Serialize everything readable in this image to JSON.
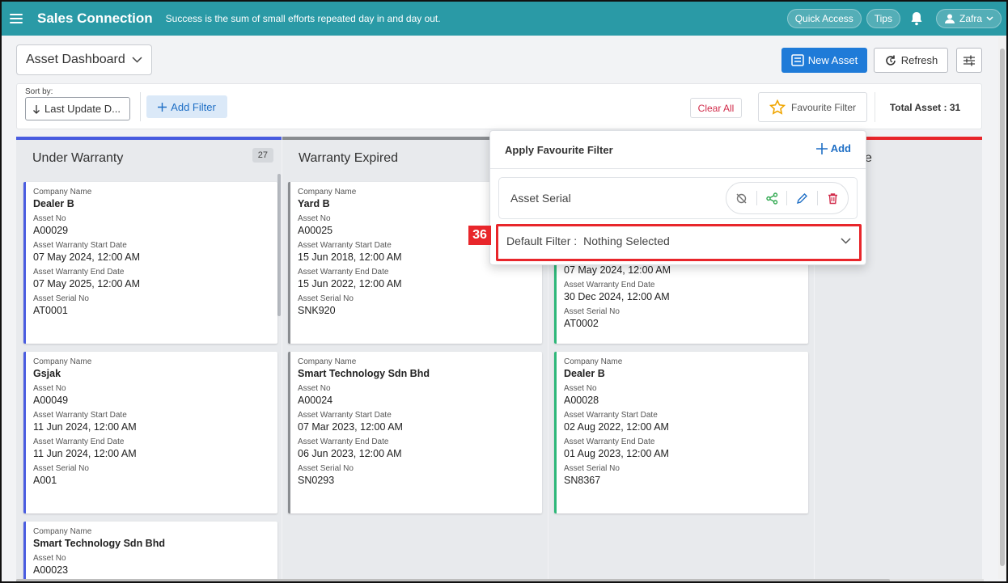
{
  "topbar": {
    "app_title": "Sales Connection",
    "tagline": "Success is the sum of small efforts repeated day in and day out.",
    "quick_access": "Quick Access",
    "tips": "Tips",
    "user_name": "Zafra",
    "color": "#2a9aa6"
  },
  "header": {
    "dashboard_select": "Asset Dashboard",
    "new_asset": "New Asset",
    "refresh": "Refresh"
  },
  "filter_bar": {
    "sort_label": "Sort by:",
    "sort_value": "Last Update D...",
    "add_filter": "Add Filter",
    "clear_all": "Clear All",
    "favourite_filter": "Favourite Filter",
    "total_asset": "Total Asset : 31"
  },
  "columns": [
    {
      "title": "Under Warranty",
      "count": "27",
      "color": "#4a5de0",
      "cards": [
        {
          "company": "Dealer B",
          "asset_no": "A00029",
          "start": "07 May 2024, 12:00 AM",
          "end": "07 May 2025, 12:00 AM",
          "serial": "AT0001"
        },
        {
          "company": "Gsjak",
          "asset_no": "A00049",
          "start": "11 Jun 2024, 12:00 AM",
          "end": "11 Jun 2024, 12:00 AM",
          "serial": "A001"
        },
        {
          "company": "Smart Technology Sdn Bhd",
          "asset_no": "A00023"
        }
      ]
    },
    {
      "title": "Warranty Expired",
      "color": "#8a8d91",
      "cards": [
        {
          "company": "Yard B",
          "asset_no": "A00025",
          "start": "15 Jun 2018, 12:00 AM",
          "end": "15 Jun 2022, 12:00 AM",
          "serial": "SNK920"
        },
        {
          "company": "Smart Technology Sdn Bhd",
          "asset_no": "A00024",
          "start": "07 Mar 2023, 12:00 AM",
          "end": "06 Jun 2023, 12:00 AM",
          "serial": "SN0293"
        }
      ]
    },
    {
      "title": "",
      "color": "#2fb87a",
      "cards": [
        {
          "start": "07 May 2024, 12:00 AM",
          "end": "30 Dec 2024, 12:00 AM",
          "serial": "AT0002"
        },
        {
          "company": "Dealer B",
          "asset_no": "A00028",
          "start": "02 Aug 2022, 12:00 AM",
          "end": "01 Aug 2023, 12:00 AM",
          "serial": "SN8367"
        }
      ]
    },
    {
      "title_partial": "e",
      "color": "#e8262b"
    }
  ],
  "labels": {
    "company_name": "Company Name",
    "asset_no": "Asset No",
    "start": "Asset Warranty Start Date",
    "end": "Asset Warranty End Date",
    "serial": "Asset Serial No"
  },
  "popup": {
    "title": "Apply Favourite Filter",
    "add": "Add",
    "favourite_name": "Asset Serial",
    "default_label": "Default Filter :",
    "default_value": "Nothing Selected",
    "badge": "36"
  }
}
